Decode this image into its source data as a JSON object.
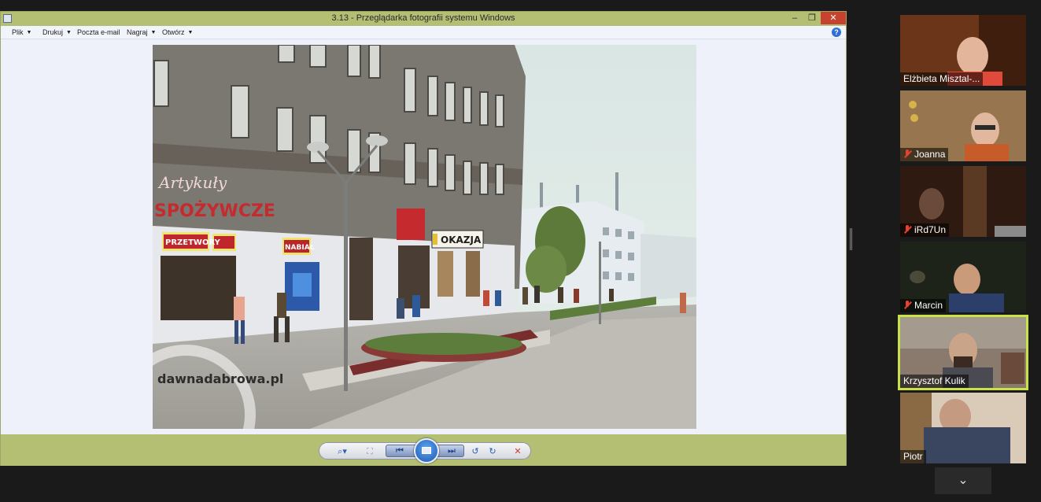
{
  "window": {
    "title": "3.13 - Przeglądarka fotografii systemu Windows",
    "min_glyph": "–",
    "max_glyph": "❐",
    "close_glyph": "✕"
  },
  "menu": {
    "items": [
      {
        "label": "Plik",
        "has_caret": true
      },
      {
        "label": "Drukuj",
        "has_caret": true
      },
      {
        "label": "Poczta e-mail",
        "has_caret": false
      },
      {
        "label": "Nagraj",
        "has_caret": true
      },
      {
        "label": "Otwórz",
        "has_caret": true
      }
    ],
    "caret_glyph": "▼",
    "help_glyph": "?"
  },
  "photo": {
    "watermark": "dawnadabrowa.pl",
    "signs": {
      "main": "SPOŻYWCZE",
      "artykuly": "Artykuły",
      "przetwory": "PRZETWORY",
      "nabial": "NABIAŁ",
      "okazja": "OKAZJA"
    }
  },
  "controls": {
    "zoom_glyph": "⌕▾",
    "fit_glyph": "⛶",
    "prev_glyph": "⏮",
    "next_glyph": "⏭",
    "rotate_ccw_glyph": "↺",
    "rotate_cw_glyph": "↻",
    "delete_glyph": "✕"
  },
  "participants": [
    {
      "name": "Elżbieta Misztal-...",
      "muted": false
    },
    {
      "name": "Joanna",
      "muted": true
    },
    {
      "name": "iRd7Un",
      "muted": true
    },
    {
      "name": "Marcin",
      "muted": true
    },
    {
      "name": "Krzysztof Kulik",
      "muted": false,
      "active": true
    },
    {
      "name": "Piotr",
      "muted": false
    }
  ],
  "panel": {
    "expand_glyph": "⌄"
  },
  "colors": {
    "titlebar": "#b4bf74",
    "active_outline": "#c9e24a",
    "muted_mic": "#e8402f"
  }
}
